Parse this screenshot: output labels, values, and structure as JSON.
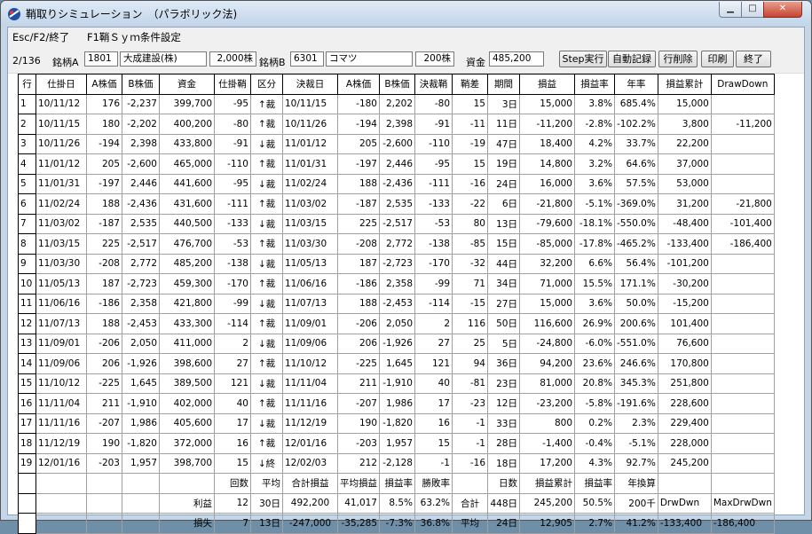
{
  "window": {
    "title": "鞘取りシミュレーション　（パラボリック法)"
  },
  "menu": [
    "Esc/F2/終了",
    "F1鞘Ｓｙｍ条件設定"
  ],
  "toolbar": {
    "page": "2/136",
    "label_a": "銘柄A",
    "code_a": "1801",
    "name_a": "大成建設(株)",
    "qty_a": "2,000株",
    "label_b": "銘柄B",
    "code_b": "6301",
    "name_b": "コマツ",
    "qty_b": "200株",
    "capital_label": "資金",
    "capital": "485,200",
    "btn_step": "Step実行",
    "btn_auto": "自動記録",
    "btn_delete": "行削除",
    "btn_print": "印刷",
    "btn_exit": "終了"
  },
  "table": {
    "headers": [
      "行",
      "仕掛日",
      "A株価",
      "B株価",
      "資金",
      "仕掛鞘",
      "区分",
      "決裁日",
      "A株価",
      "B株価",
      "決裁鞘",
      "鞘差",
      "期間",
      "損益",
      "損益率",
      "年率",
      "損益累計",
      "DrawDown"
    ],
    "rows": [
      [
        "1",
        "10/11/12",
        "176",
        "-2,237",
        "399,700",
        "-95",
        "↑裁",
        "10/11/15",
        "-180",
        "2,202",
        "-80",
        "15",
        "3日",
        "15,000",
        "3.8%",
        "685.4%",
        "15,000",
        ""
      ],
      [
        "2",
        "10/11/15",
        "180",
        "-2,202",
        "400,200",
        "-80",
        "↑裁",
        "10/11/26",
        "-194",
        "2,398",
        "-91",
        "-11",
        "11日",
        "-11,200",
        "-2.8%",
        "-102.2%",
        "3,800",
        "-11,200"
      ],
      [
        "3",
        "10/11/26",
        "-194",
        "2,398",
        "433,800",
        "-91",
        "↓裁",
        "11/01/12",
        "205",
        "-2,600",
        "-110",
        "-19",
        "47日",
        "18,400",
        "4.2%",
        "33.7%",
        "22,200",
        ""
      ],
      [
        "4",
        "11/01/12",
        "205",
        "-2,600",
        "465,000",
        "-110",
        "↑裁",
        "11/01/31",
        "-197",
        "2,446",
        "-95",
        "15",
        "19日",
        "14,800",
        "3.2%",
        "64.6%",
        "37,000",
        ""
      ],
      [
        "5",
        "11/01/31",
        "-197",
        "2,446",
        "441,600",
        "-95",
        "↓裁",
        "11/02/24",
        "188",
        "-2,436",
        "-111",
        "-16",
        "24日",
        "16,000",
        "3.6%",
        "57.5%",
        "53,000",
        ""
      ],
      [
        "6",
        "11/02/24",
        "188",
        "-2,436",
        "431,600",
        "-111",
        "↑裁",
        "11/03/02",
        "-187",
        "2,535",
        "-133",
        "-22",
        "6日",
        "-21,800",
        "-5.1%",
        "-369.0%",
        "31,200",
        "-21,800"
      ],
      [
        "7",
        "11/03/02",
        "-187",
        "2,535",
        "440,500",
        "-133",
        "↓裁",
        "11/03/15",
        "225",
        "-2,517",
        "-53",
        "80",
        "13日",
        "-79,600",
        "-18.1%",
        "-550.0%",
        "-48,400",
        "-101,400"
      ],
      [
        "8",
        "11/03/15",
        "225",
        "-2,517",
        "476,700",
        "-53",
        "↑裁",
        "11/03/30",
        "-208",
        "2,772",
        "-138",
        "-85",
        "15日",
        "-85,000",
        "-17.8%",
        "-465.2%",
        "-133,400",
        "-186,400"
      ],
      [
        "9",
        "11/03/30",
        "-208",
        "2,772",
        "485,200",
        "-138",
        "↓裁",
        "11/05/13",
        "187",
        "-2,723",
        "-170",
        "-32",
        "44日",
        "32,200",
        "6.6%",
        "56.4%",
        "-101,200",
        ""
      ],
      [
        "10",
        "11/05/13",
        "187",
        "-2,723",
        "459,300",
        "-170",
        "↑裁",
        "11/06/16",
        "-186",
        "2,358",
        "-99",
        "71",
        "34日",
        "71,000",
        "15.5%",
        "171.1%",
        "-30,200",
        ""
      ],
      [
        "11",
        "11/06/16",
        "-186",
        "2,358",
        "421,800",
        "-99",
        "↓裁",
        "11/07/13",
        "188",
        "-2,453",
        "-114",
        "-15",
        "27日",
        "15,000",
        "3.6%",
        "50.0%",
        "-15,200",
        ""
      ],
      [
        "12",
        "11/07/13",
        "188",
        "-2,453",
        "433,300",
        "-114",
        "↑裁",
        "11/09/01",
        "-206",
        "2,050",
        "2",
        "116",
        "50日",
        "116,600",
        "26.9%",
        "200.6%",
        "101,400",
        ""
      ],
      [
        "13",
        "11/09/01",
        "-206",
        "2,050",
        "411,000",
        "2",
        "↓裁",
        "11/09/06",
        "206",
        "-1,926",
        "27",
        "25",
        "5日",
        "-24,800",
        "-6.0%",
        "-551.0%",
        "76,600",
        ""
      ],
      [
        "14",
        "11/09/06",
        "206",
        "-1,926",
        "398,600",
        "27",
        "↑裁",
        "11/10/12",
        "-225",
        "1,645",
        "121",
        "94",
        "36日",
        "94,200",
        "23.6%",
        "246.6%",
        "170,800",
        ""
      ],
      [
        "15",
        "11/10/12",
        "-225",
        "1,645",
        "389,500",
        "121",
        "↓裁",
        "11/11/04",
        "211",
        "-1,910",
        "40",
        "-81",
        "23日",
        "81,000",
        "20.8%",
        "345.3%",
        "251,800",
        ""
      ],
      [
        "16",
        "11/11/04",
        "211",
        "-1,910",
        "402,000",
        "40",
        "↑裁",
        "11/11/16",
        "-207",
        "1,986",
        "17",
        "-23",
        "12日",
        "-23,200",
        "-5.8%",
        "-191.6%",
        "228,600",
        ""
      ],
      [
        "17",
        "11/11/16",
        "-207",
        "1,986",
        "405,600",
        "17",
        "↓裁",
        "11/12/19",
        "190",
        "-1,820",
        "16",
        "-1",
        "33日",
        "800",
        "0.2%",
        "2.3%",
        "229,400",
        ""
      ],
      [
        "18",
        "11/12/19",
        "190",
        "-1,820",
        "372,000",
        "16",
        "↑裁",
        "12/01/16",
        "-203",
        "1,957",
        "15",
        "-1",
        "28日",
        "-1,400",
        "-0.4%",
        "-5.1%",
        "228,000",
        ""
      ],
      [
        "19",
        "12/01/16",
        "-203",
        "1,957",
        "398,700",
        "15",
        "↓終",
        "12/02/03",
        "212",
        "-2,128",
        "-1",
        "-16",
        "18日",
        "17,200",
        "4.3%",
        "92.7%",
        "245,200",
        ""
      ]
    ],
    "summary_header": [
      "",
      "",
      "",
      "",
      "",
      "回数",
      "平均",
      "合計損益",
      "平均損益",
      "損益率",
      "勝敗率",
      "",
      "日数",
      "損益累計",
      "損益率",
      "年換算",
      "",
      ""
    ],
    "summary_rows": [
      [
        "",
        "",
        "",
        "",
        "利益",
        "12",
        "30日",
        "492,200",
        "41,017",
        "8.5%",
        "63.2%",
        "合計",
        "448日",
        "245,200",
        "50.5%",
        "200千",
        "DrwDwn",
        "MaxDrwDwn"
      ],
      [
        "",
        "",
        "",
        "",
        "損失",
        "7",
        "13日",
        "-247,000",
        "-35,285",
        "-7.3%",
        "36.8%",
        "平均",
        "24日",
        "12,905",
        "2.7%",
        "41.2%",
        "-133,400",
        "-186,400"
      ]
    ]
  }
}
